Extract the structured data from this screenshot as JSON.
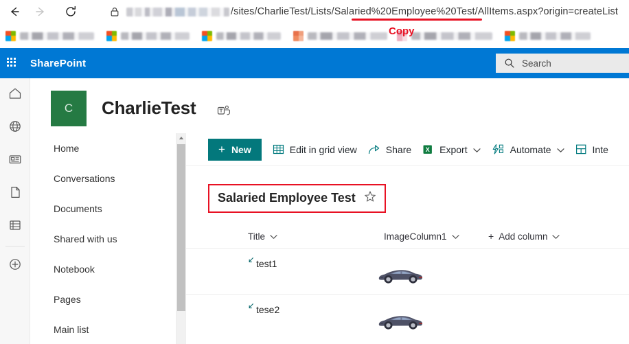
{
  "browser": {
    "back_icon": "back-arrow-icon",
    "forward_icon": "forward-arrow-icon",
    "reload_icon": "reload-icon",
    "lock_icon": "lock-icon",
    "url_visible_text": "/sites/CharlieTest/Lists/Salaried%20Employee%20Test/AllItems.aspx?origin=createList",
    "url_highlight_segment": "Salaried%20Employee%20Test",
    "bookmarks": [
      {
        "label": "",
        "icon": "microsoft-icon"
      },
      {
        "label": "",
        "icon": "microsoft-icon"
      },
      {
        "label": "",
        "icon": "microsoft-icon"
      },
      {
        "label": "",
        "icon": "app-icon"
      },
      {
        "label": "",
        "icon": "app-icon"
      },
      {
        "label": "",
        "icon": "microsoft-icon"
      }
    ],
    "annotation_copy": "Copy"
  },
  "suite": {
    "waffle_icon": "waffle-grid-icon",
    "brand": "SharePoint",
    "search_icon": "search-icon",
    "search_placeholder": "Search",
    "search_value": ""
  },
  "rail": {
    "items": [
      {
        "name": "home-icon"
      },
      {
        "name": "globe-icon"
      },
      {
        "name": "news-icon"
      },
      {
        "name": "document-icon"
      },
      {
        "name": "list-icon"
      },
      {
        "name": "create-icon"
      }
    ]
  },
  "site": {
    "logo_letter": "C",
    "logo_color": "#257a43",
    "title": "CharlieTest",
    "teams_icon": "teams-icon"
  },
  "nav": {
    "items": [
      {
        "label": "Home"
      },
      {
        "label": "Conversations"
      },
      {
        "label": "Documents"
      },
      {
        "label": "Shared with us"
      },
      {
        "label": "Notebook"
      },
      {
        "label": "Pages"
      },
      {
        "label": "Main list"
      }
    ]
  },
  "commandbar": {
    "new_label": "New",
    "new_plus": "+",
    "new_color": "#03787c",
    "items": [
      {
        "label": "Edit in grid view",
        "icon": "grid-icon",
        "caret": false
      },
      {
        "label": "Share",
        "icon": "share-icon",
        "caret": false
      },
      {
        "label": "Export",
        "icon": "excel-icon",
        "caret": true
      },
      {
        "label": "Automate",
        "icon": "automate-icon",
        "caret": true
      },
      {
        "label": "Inte",
        "icon": "integrate-icon",
        "caret": false
      }
    ],
    "caret_glyph": "⌄"
  },
  "list": {
    "title": "Salaried Employee Test",
    "star_icon": "favorite-star-icon",
    "highlight_color": "#e81123",
    "columns": [
      {
        "label": "Title",
        "caret": true
      },
      {
        "label": "ImageColumn1",
        "caret": true
      },
      {
        "label": "Add column",
        "caret": true,
        "plus": "+"
      }
    ],
    "rows": [
      {
        "title": "test1",
        "image": "car-image",
        "link_icon": "open-in-new-icon"
      },
      {
        "title": "tese2",
        "image": "car-image",
        "link_icon": "open-in-new-icon"
      }
    ]
  }
}
